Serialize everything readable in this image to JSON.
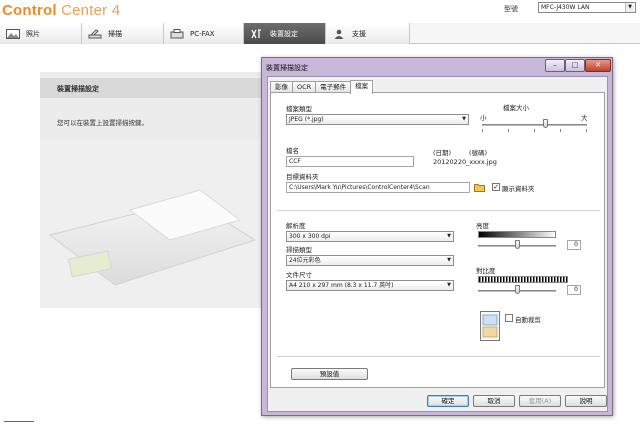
{
  "app": {
    "brand_main": "Control",
    "brand_rest": " Center 4",
    "model_label": "型號",
    "model_value": "MFC-J430W LAN"
  },
  "main_tabs": [
    {
      "label": "照片",
      "icon": "photo-icon"
    },
    {
      "label": "掃描",
      "icon": "scanner-icon"
    },
    {
      "label": "PC-FAX",
      "icon": "fax-icon"
    },
    {
      "label": "裝置設定",
      "icon": "tools-icon"
    },
    {
      "label": "支援",
      "icon": "support-person-icon"
    }
  ],
  "background_page": {
    "title": "裝置掃描設定",
    "description": "您可以在裝置上設置掃描按鍵。"
  },
  "dialog": {
    "title": "裝置掃描設定",
    "tabs": [
      "影像",
      "OCR",
      "電子郵件",
      "檔案"
    ],
    "active_tab": "檔案",
    "file_type_label": "檔案類型",
    "file_type_value": "JPEG (*.jpg)",
    "file_size_label": "檔案大小",
    "file_size_small": "小",
    "file_size_large": "大",
    "file_name_label": "檔名",
    "file_name_value": "CCF",
    "date_label": "(日期)",
    "number_label": "(號碼)",
    "file_name_preview": "20120220_xxxx.jpg",
    "dest_folder_label": "目標資料夾",
    "dest_folder_value": "C:\\Users\\Mark Yu\\Pictures\\ControlCenter4\\Scan",
    "show_folder_label": "顯示資料夾",
    "show_folder_checked": true,
    "resolution_label": "解析度",
    "resolution_value": "300 x 300 dpi",
    "scan_type_label": "掃描類型",
    "scan_type_value": "24位元彩色",
    "doc_size_label": "文件尺寸",
    "doc_size_value": "A4 210 x 297 mm (8.3 x 11.7 英吋)",
    "brightness_label": "亮度",
    "brightness_value": "0",
    "contrast_label": "對比度",
    "contrast_value": "0",
    "auto_crop_label": "自動裁剪",
    "auto_crop_checked": false,
    "default_button": "預設值",
    "ok_button": "確定",
    "cancel_button": "取消",
    "apply_button": "套用(A)",
    "help_button": "說明",
    "min_glyph": "–",
    "max_glyph": "□",
    "close_glyph": "✕"
  }
}
